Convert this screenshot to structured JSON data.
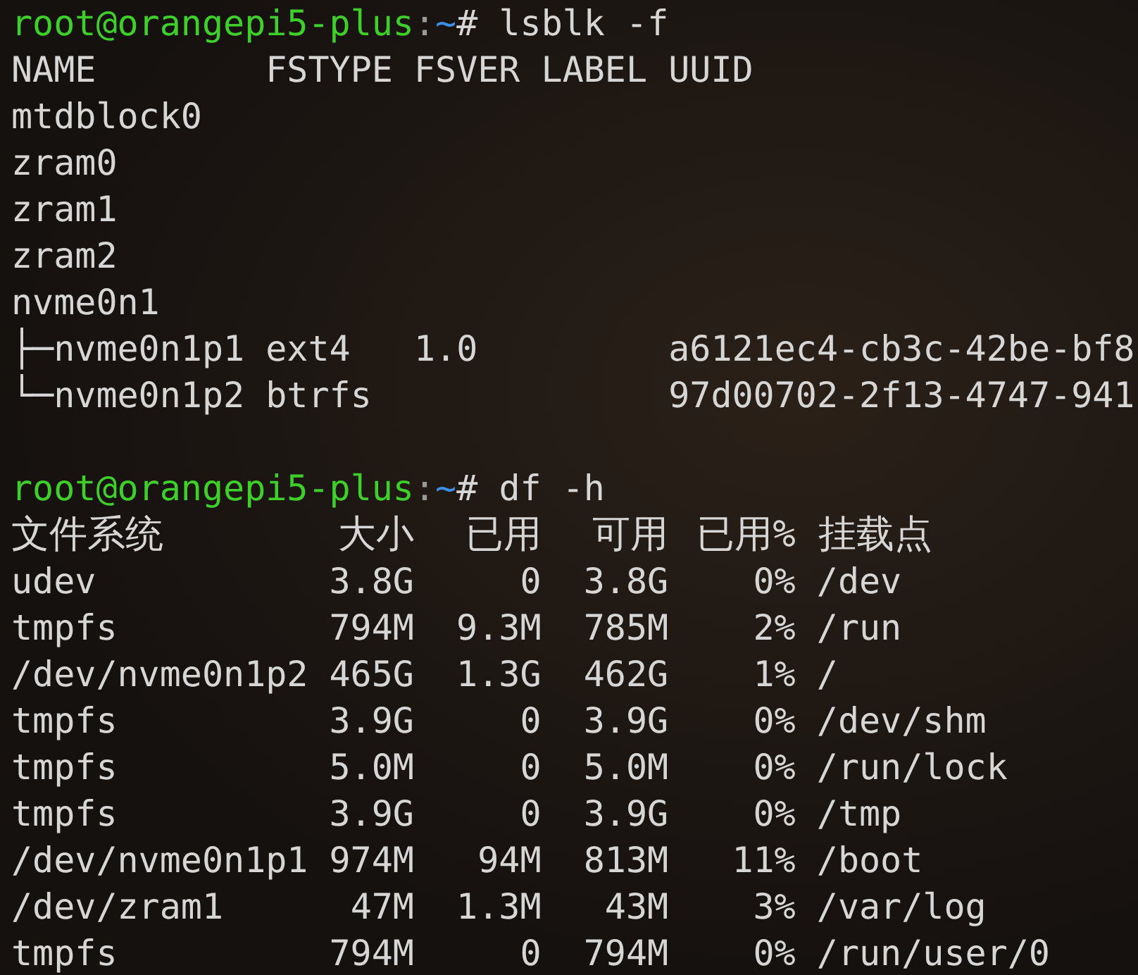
{
  "lsblk": {
    "prompt": {
      "user_host": "root@orangepi5-plus",
      "separator": ":",
      "path": "~",
      "symbol": "#",
      "command": "lsblk -f"
    },
    "header": "NAME        FSTYPE FSVER LABEL UUID",
    "rows": [
      "mtdblock0",
      "zram0",
      "zram1",
      "zram2",
      "nvme0n1",
      "├─nvme0n1p1 ext4   1.0         a6121ec4-cb3c-42be-bf8",
      "└─nvme0n1p2 btrfs              97d00702-2f13-4747-941"
    ]
  },
  "df": {
    "prompt": {
      "user_host": "root@orangepi5-plus",
      "separator": ":",
      "path": "~",
      "symbol": "#",
      "command": "df -h"
    },
    "columns": [
      "文件系统",
      "大小",
      "已用",
      "可用",
      "已用%",
      "挂载点"
    ],
    "rows": [
      [
        "udev",
        "3.8G",
        "0",
        "3.8G",
        "0%",
        "/dev"
      ],
      [
        "tmpfs",
        "794M",
        "9.3M",
        "785M",
        "2%",
        "/run"
      ],
      [
        "/dev/nvme0n1p2",
        "465G",
        "1.3G",
        "462G",
        "1%",
        "/"
      ],
      [
        "tmpfs",
        "3.9G",
        "0",
        "3.9G",
        "0%",
        "/dev/shm"
      ],
      [
        "tmpfs",
        "5.0M",
        "0",
        "5.0M",
        "0%",
        "/run/lock"
      ],
      [
        "tmpfs",
        "3.9G",
        "0",
        "3.9G",
        "0%",
        "/tmp"
      ],
      [
        "/dev/nvme0n1p1",
        "974M",
        "94M",
        "813M",
        "11%",
        "/boot"
      ],
      [
        "/dev/zram1",
        "47M",
        "1.3M",
        "43M",
        "3%",
        "/var/log"
      ],
      [
        "tmpfs",
        "794M",
        "0",
        "794M",
        "0%",
        "/run/user/0"
      ]
    ]
  }
}
